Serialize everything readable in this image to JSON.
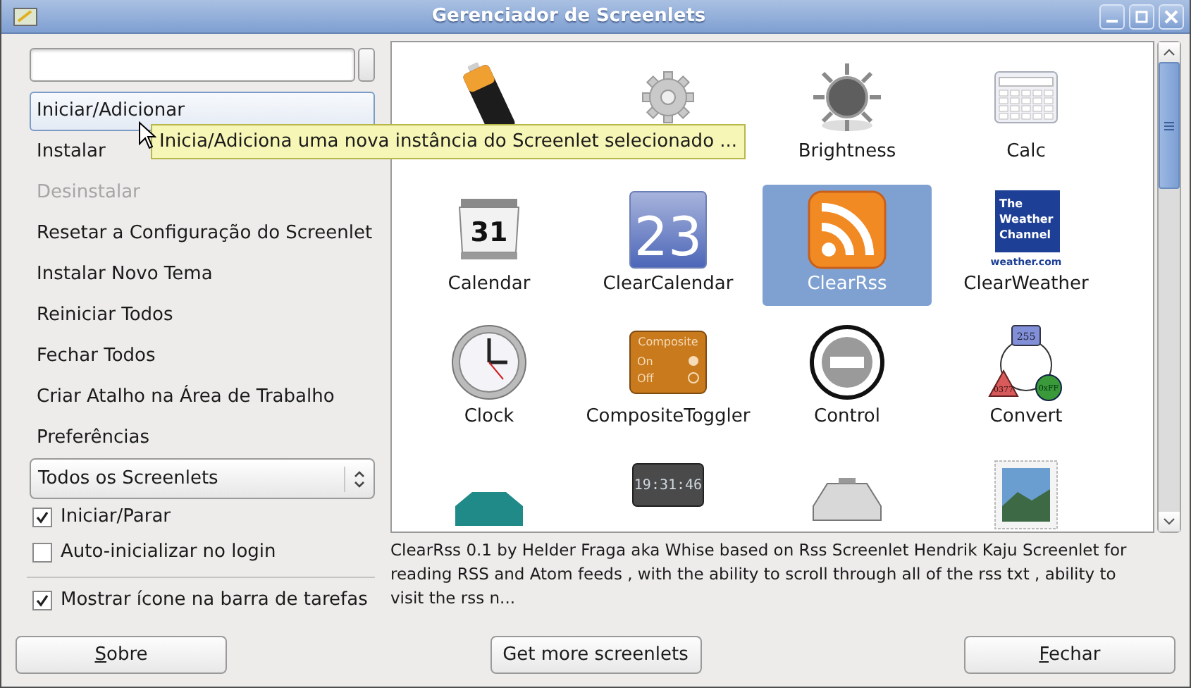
{
  "window": {
    "title": "Gerenciador de Screenlets"
  },
  "actions": [
    {
      "label": "Iniciar/Adicionar",
      "selected": true,
      "disabled": false
    },
    {
      "label": "Instalar",
      "selected": false,
      "disabled": false
    },
    {
      "label": "Desinstalar",
      "selected": false,
      "disabled": true
    },
    {
      "label": "Resetar a Configuração do Screenlet",
      "selected": false,
      "disabled": false
    },
    {
      "label": "Instalar Novo Tema",
      "selected": false,
      "disabled": false
    },
    {
      "label": "Reiniciar Todos",
      "selected": false,
      "disabled": false
    },
    {
      "label": "Fechar Todos",
      "selected": false,
      "disabled": false
    },
    {
      "label": "Criar Atalho na Área de Trabalho",
      "selected": false,
      "disabled": false
    },
    {
      "label": "Preferências",
      "selected": false,
      "disabled": false
    }
  ],
  "tooltip": "Inicia/Adiciona uma nova instância do Screenlet selecionado ...",
  "filter": {
    "value": "Todos os Screenlets"
  },
  "options": [
    {
      "label": "Iniciar/Parar",
      "checked": true
    },
    {
      "label": "Auto-inicializar no login",
      "checked": false
    }
  ],
  "taskbar_option": {
    "label": "Mostrar ícone na barra de tarefas",
    "checked": true
  },
  "screenlets": [
    {
      "selected": false
    },
    {
      "selected": false
    },
    {
      "label": "Brightness",
      "selected": false
    },
    {
      "label": "Calc",
      "selected": false
    },
    {
      "label": "Calendar",
      "selected": false,
      "icon_text": [
        "31"
      ]
    },
    {
      "label": "ClearCalendar",
      "selected": false,
      "icon_text": [
        "23"
      ]
    },
    {
      "label": "ClearRss",
      "selected": true
    },
    {
      "label": "ClearWeather",
      "selected": false,
      "icon_text": [
        "The",
        "Weather",
        "Channel",
        "weather.com"
      ]
    },
    {
      "label": "Clock",
      "selected": false
    },
    {
      "label": "CompositeToggler",
      "selected": false,
      "icon_text": [
        "Composite",
        "On",
        "Off"
      ]
    },
    {
      "label": "Control",
      "selected": false
    },
    {
      "label": "Convert",
      "selected": false,
      "icon_text": [
        "255",
        "0377",
        "0xFF"
      ]
    },
    {
      "selected": false
    },
    {
      "selected": false,
      "icon_text": [
        "19:31:46"
      ]
    },
    {
      "selected": false
    },
    {
      "selected": false
    }
  ],
  "description": "ClearRss 0.1 by Helder Fraga aka Whise based on Rss Screenlet Hendrik Kaju Screenlet for reading RSS and Atom feeds , with the ability to scroll through all of the rss txt , ability to visit the rss n...",
  "buttons": [
    {
      "label": "Sobre",
      "mnemonic": true
    },
    {
      "label": "Get more screenlets",
      "mnemonic": false
    },
    {
      "label": "Fechar",
      "mnemonic": true
    }
  ]
}
